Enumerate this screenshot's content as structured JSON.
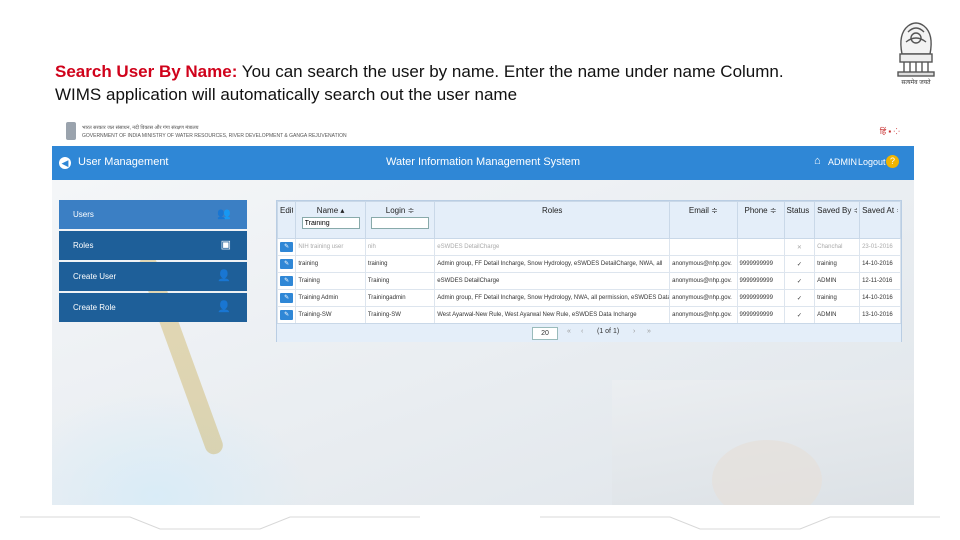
{
  "caption": {
    "highlight": "Search User  By Name:",
    "line1_rest": " You can search the user by name. Enter the name under name Column.",
    "line2": "WIMS application will automatically search out the user name"
  },
  "emblem": {
    "icon": "national-emblem-icon",
    "text": "सत्यमेव जयते"
  },
  "gov_strip": {
    "line1": "भारत सरकार   जल संसाधन, नदी विकास और गंगा संरक्षण मंत्रालय",
    "line2": "GOVERNMENT OF INDIA   MINISTRY OF WATER RESOURCES, RIVER DEVELOPMENT & GANGA REJUVENATION",
    "right": "हिं ▪  ⁘"
  },
  "topbar": {
    "title": "User Management",
    "center": "Water Information Management System",
    "user": "ADMIN",
    "logout": "Logout"
  },
  "sidebar": {
    "items": [
      {
        "label": "Users",
        "icon": "users-icon",
        "active": true
      },
      {
        "label": "Roles",
        "icon": "roles-icon",
        "active": false
      },
      {
        "label": "Create User",
        "icon": "create-user-icon",
        "active": false
      },
      {
        "label": "Create Role",
        "icon": "create-role-icon",
        "active": false
      }
    ]
  },
  "grid": {
    "columns": {
      "edit": "Edit",
      "name": "Name ▴",
      "login": "Login ≑",
      "roles": "Roles",
      "email": "Email ≑",
      "phone": "Phone ≑",
      "status": "Status ≑",
      "saved_by": "Saved By ≑",
      "saved_at": "Saved At ≑"
    },
    "filters": {
      "name_value": "Training",
      "login_value": ""
    },
    "rows": [
      {
        "name": "NIH training user",
        "login": "nih",
        "roles": "eSWDES DetailCharge",
        "email": "",
        "phone": "",
        "status": "✕",
        "saved_by": "Chanchal",
        "saved_at": "23-01-2016",
        "dim": true
      },
      {
        "name": "training",
        "login": "training",
        "roles": "Admin group, FF Detail Incharge, Snow Hydrology, eSWDES DetailCharge, NWA, all",
        "email": "anonymous@nhp.gov.",
        "phone": "9999999999",
        "status": "✓",
        "saved_by": "training",
        "saved_at": "14-10-2016",
        "dim": false
      },
      {
        "name": "Training",
        "login": "Training",
        "roles": "eSWDES DetailCharge",
        "email": "anonymous@nhp.gov.",
        "phone": "9999999999",
        "status": "✓",
        "saved_by": "ADMIN",
        "saved_at": "12-11-2016",
        "dim": false
      },
      {
        "name": "Training Admin",
        "login": "Trainingadmin",
        "roles": "Admin group, FF Detail Incharge, Snow Hydrology, NWA, all permission, eSWDES Data",
        "email": "anonymous@nhp.gov.",
        "phone": "9999999999",
        "status": "✓",
        "saved_by": "training",
        "saved_at": "14-10-2016",
        "dim": false
      },
      {
        "name": "Training-SW",
        "login": "Training-SW",
        "roles": "West Ayarwal-New Rule, West Ayarwal New Rule, eSWDES Data Incharge",
        "email": "anonymous@nhp.gov.",
        "phone": "9999999999",
        "status": "✓",
        "saved_by": "ADMIN",
        "saved_at": "13-10-2016",
        "dim": false
      }
    ],
    "pager": {
      "page_size": "20",
      "info": "(1 of 1)",
      "first": "«",
      "prev": "‹",
      "next": "›",
      "last": "»"
    }
  }
}
